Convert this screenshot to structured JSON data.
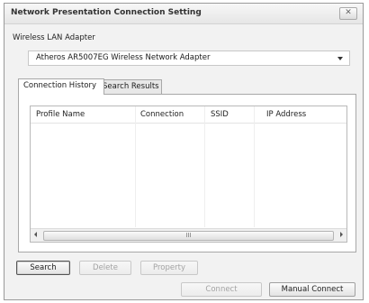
{
  "window": {
    "title": "Network Presentation Connection Setting",
    "close_label": "✕"
  },
  "adapter": {
    "label": "Wireless LAN Adapter",
    "selected": "Atheros AR5007EG Wireless Network Adapter"
  },
  "tabs": [
    {
      "label": "Connection History",
      "active": true
    },
    {
      "label": "Search Results",
      "active": false
    }
  ],
  "table": {
    "columns": [
      "Profile Name",
      "Connection",
      "SSID",
      "IP Address"
    ],
    "rows": [],
    "scroll_grip": "III"
  },
  "buttons": {
    "search": "Search",
    "delete": "Delete",
    "property": "Property",
    "connect": "Connect",
    "manual_connect": "Manual Connect"
  }
}
